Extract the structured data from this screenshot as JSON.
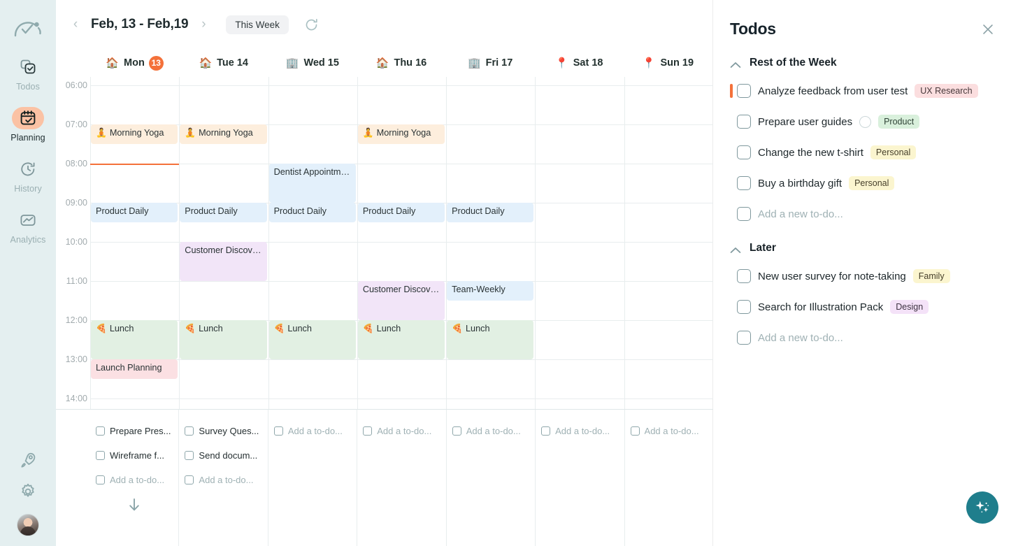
{
  "sidebar": {
    "logo_icon": "activity-arc-icon",
    "items": [
      {
        "label": "Todos",
        "icon": "todos-icon",
        "active": false
      },
      {
        "label": "Planning",
        "icon": "calendar-check-icon",
        "active": true
      },
      {
        "label": "History",
        "icon": "clock-history-icon",
        "active": false
      },
      {
        "label": "Analytics",
        "icon": "analytics-icon",
        "active": false
      }
    ],
    "bottom": [
      {
        "name": "rocket-icon"
      },
      {
        "name": "gear-icon"
      },
      {
        "name": "avatar"
      }
    ],
    "active_pill_color": "#fbc2a4",
    "background": "#e4eff0"
  },
  "toolbar": {
    "prev_label": "‹",
    "next_label": "›",
    "range": "Feb, 13 - Feb,19",
    "this_week_label": "This Week",
    "refresh_icon": "refresh-icon"
  },
  "days": [
    {
      "emoji": "🏠",
      "label": "Mon",
      "date": "13",
      "badge": true
    },
    {
      "emoji": "🏠",
      "label": "Tue 14",
      "date": "14",
      "badge": false
    },
    {
      "emoji": "🏢",
      "label": "Wed 15",
      "date": "15",
      "badge": false
    },
    {
      "emoji": "🏠",
      "label": "Thu 16",
      "date": "16",
      "badge": false
    },
    {
      "emoji": "🏢",
      "label": "Fri 17",
      "date": "17",
      "badge": false
    },
    {
      "emoji": "📍",
      "label": "Sat 18",
      "date": "18",
      "badge": false
    },
    {
      "emoji": "📍",
      "label": "Sun 19",
      "date": "19",
      "badge": false
    }
  ],
  "hours": [
    "06:00",
    "07:00",
    "08:00",
    "09:00",
    "10:00",
    "11:00",
    "12:00",
    "13:00",
    "14:00"
  ],
  "now_indicator": {
    "time": "08:00",
    "color": "#f4713a",
    "day": 0
  },
  "events": [
    {
      "title": "Morning Yoga",
      "emoji": "🧘",
      "day": 0,
      "start": "07:00",
      "end": "07:30",
      "color": "#fdeedd"
    },
    {
      "title": "Morning Yoga",
      "emoji": "🧘",
      "day": 1,
      "start": "07:00",
      "end": "07:30",
      "color": "#fdeedd"
    },
    {
      "title": "Morning Yoga",
      "emoji": "🧘",
      "day": 3,
      "start": "07:00",
      "end": "07:30",
      "color": "#fdeedd"
    },
    {
      "title": "Dentist Appointme...",
      "emoji": "",
      "day": 2,
      "start": "08:00",
      "end": "09:00",
      "color": "#e3f0fb"
    },
    {
      "title": "Product Daily",
      "emoji": "",
      "day": 0,
      "start": "09:00",
      "end": "09:30",
      "color": "#e3f0fb"
    },
    {
      "title": "Product Daily",
      "emoji": "",
      "day": 1,
      "start": "09:00",
      "end": "09:30",
      "color": "#e3f0fb"
    },
    {
      "title": "Product Daily",
      "emoji": "",
      "day": 2,
      "start": "09:00",
      "end": "09:30",
      "color": "#e3f0fb"
    },
    {
      "title": "Product Daily",
      "emoji": "",
      "day": 3,
      "start": "09:00",
      "end": "09:30",
      "color": "#e3f0fb"
    },
    {
      "title": "Product Daily",
      "emoji": "",
      "day": 4,
      "start": "09:00",
      "end": "09:30",
      "color": "#e3f0fb"
    },
    {
      "title": "Customer Discover...",
      "emoji": "",
      "day": 1,
      "start": "10:00",
      "end": "11:00",
      "color": "#f2e5f8"
    },
    {
      "title": "Customer Discover...",
      "emoji": "",
      "day": 3,
      "start": "11:00",
      "end": "12:00",
      "color": "#f2e5f8"
    },
    {
      "title": "Team-Weekly",
      "emoji": "",
      "day": 4,
      "start": "11:00",
      "end": "11:30",
      "color": "#e3f0fb"
    },
    {
      "title": "Lunch",
      "emoji": "🍕",
      "day": 0,
      "start": "12:00",
      "end": "13:00",
      "color": "#e2f0e3"
    },
    {
      "title": "Lunch",
      "emoji": "🍕",
      "day": 1,
      "start": "12:00",
      "end": "13:00",
      "color": "#e2f0e3"
    },
    {
      "title": "Lunch",
      "emoji": "🍕",
      "day": 2,
      "start": "12:00",
      "end": "13:00",
      "color": "#e2f0e3"
    },
    {
      "title": "Lunch",
      "emoji": "🍕",
      "day": 3,
      "start": "12:00",
      "end": "13:00",
      "color": "#e2f0e3"
    },
    {
      "title": "Lunch",
      "emoji": "🍕",
      "day": 4,
      "start": "12:00",
      "end": "13:00",
      "color": "#e2f0e3"
    },
    {
      "title": "Launch Planning",
      "emoji": "",
      "day": 0,
      "start": "13:00",
      "end": "13:30",
      "color": "#fbe0e3"
    }
  ],
  "day_todos": [
    {
      "items": [
        "Prepare Pres...",
        "Wireframe f..."
      ],
      "placeholder": "Add a to-do..."
    },
    {
      "items": [
        "Survey Ques...",
        "Send docum..."
      ],
      "placeholder": "Add a to-do..."
    },
    {
      "items": [],
      "placeholder": "Add a to-do..."
    },
    {
      "items": [],
      "placeholder": "Add a to-do..."
    },
    {
      "items": [],
      "placeholder": "Add a to-do..."
    },
    {
      "items": [],
      "placeholder": "Add a to-do..."
    },
    {
      "items": [],
      "placeholder": "Add a to-do..."
    }
  ],
  "scroll_down_icon": "arrow-down-icon",
  "panel": {
    "title": "Todos",
    "close_icon": "close-icon",
    "groups": [
      {
        "name": "Rest of the Week",
        "collapse_icon": "chevron-up-icon",
        "todos": [
          {
            "label": "Analyze feedback from user test",
            "tag": "UX Research",
            "tag_bg": "#fbdedf",
            "tag_fg": "#46383a",
            "accent": "#f4713a",
            "circle": false
          },
          {
            "label": "Prepare user guides",
            "tag": "Product",
            "tag_bg": "#d9f0dc",
            "tag_fg": "#2f4336",
            "accent": "",
            "circle": true
          },
          {
            "label": "Change the new t-shirt",
            "tag": "Personal",
            "tag_bg": "#fbf5cf",
            "tag_fg": "#463f2a",
            "accent": "",
            "circle": false
          },
          {
            "label": "Buy a birthday gift",
            "tag": "Personal",
            "tag_bg": "#fbf5cf",
            "tag_fg": "#463f2a",
            "accent": "",
            "circle": false
          }
        ],
        "placeholder": "Add a new to-do..."
      },
      {
        "name": "Later",
        "collapse_icon": "chevron-up-icon",
        "todos": [
          {
            "label": "New user survey for note-taking",
            "tag": "Family",
            "tag_bg": "#fbf5cf",
            "tag_fg": "#463f2a",
            "accent": "",
            "circle": false
          },
          {
            "label": "Search for Illustration Pack",
            "tag": "Design",
            "tag_bg": "#f4e2f8",
            "tag_fg": "#3e3342",
            "accent": "",
            "circle": false
          }
        ],
        "placeholder": "Add a new to-do..."
      }
    ],
    "fab_icon": "sparkles-icon",
    "fab_color": "#1f7e8c"
  }
}
